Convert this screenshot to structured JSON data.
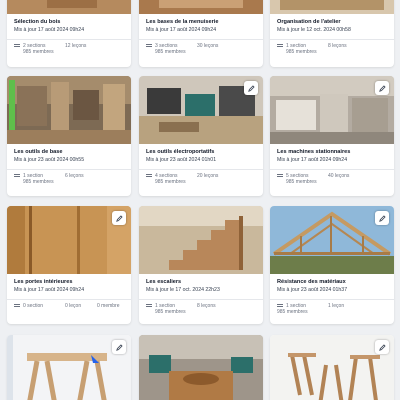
{
  "cards": [
    {
      "title": "Sélection du bois",
      "updated": "Mis à jour 17 août 2024 09h24",
      "sections": "2 sections",
      "lessons": "12 leçons",
      "members": "985 membres"
    },
    {
      "title": "Les bases de la menuiserie",
      "updated": "Mis à jour 17 août 2024 09h24",
      "sections": "3 sections",
      "lessons": "30 leçons",
      "members": "985 membres"
    },
    {
      "title": "Organisation de l'atelier",
      "updated": "Mis à jour le 12 oct. 2024 00h58",
      "sections": "1 section",
      "lessons": "8 leçons",
      "members": "985 membres"
    },
    {
      "title": "Les outils de base",
      "updated": "Mis à jour 23 août 2024 00h55",
      "sections": "1 section",
      "lessons": "6 leçons",
      "members": "985 membres"
    },
    {
      "title": "Les outils électroportatifs",
      "updated": "Mis à jour 23 août 2024 01h01",
      "sections": "4 sections",
      "lessons": "20 leçons",
      "members": "985 membres"
    },
    {
      "title": "Les machines stationnaires",
      "updated": "Mis à jour 17 août 2024 09h24",
      "sections": "5 sections",
      "lessons": "40 leçons",
      "members": "985 membres"
    },
    {
      "title": "Les portes intérieures",
      "updated": "Mis à jour 17 août 2024 09h24",
      "sections": "0 section",
      "lessons": "0 leçon",
      "members": "0 membre"
    },
    {
      "title": "Les escaliers",
      "updated": "Mis à jour le 17 oct. 2024 22h23",
      "sections": "1 section",
      "lessons": "8 leçons",
      "members": "985 membres"
    },
    {
      "title": "Résistance des matériaux",
      "updated": "Mis à jour 23 août 2024 01h37",
      "sections": "1 section",
      "lessons": "1 leçon",
      "members": "985 membres"
    },
    {
      "title": "",
      "updated": "",
      "sections": "",
      "lessons": "",
      "members": ""
    },
    {
      "title": "",
      "updated": "",
      "sections": "",
      "lessons": "",
      "members": ""
    },
    {
      "title": "",
      "updated": "",
      "sections": "",
      "lessons": "",
      "members": ""
    }
  ],
  "icons": {
    "edit": "pencil-icon",
    "sections": "list-icon"
  },
  "colors": {
    "page_bg": "#eef0f3",
    "card_bg": "#ffffff",
    "title": "#111827",
    "meta": "#6b7280"
  }
}
